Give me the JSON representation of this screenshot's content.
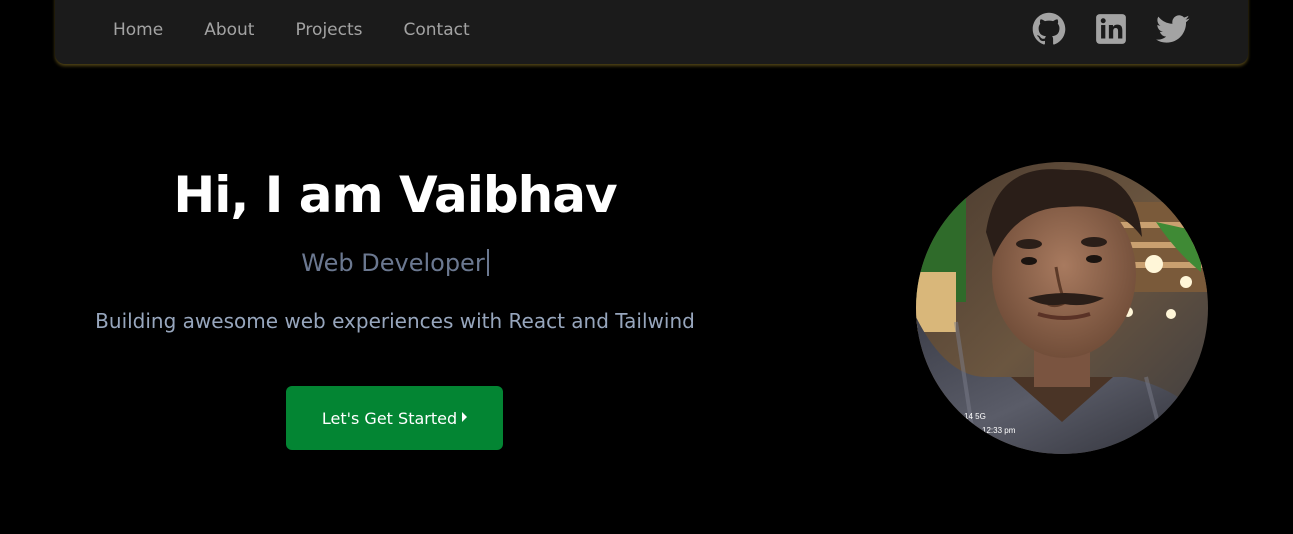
{
  "nav": {
    "links": [
      {
        "label": "Home"
      },
      {
        "label": "About"
      },
      {
        "label": "Projects"
      },
      {
        "label": "Contact"
      }
    ],
    "social_icons": [
      "github-icon",
      "linkedin-icon",
      "twitter-icon"
    ]
  },
  "hero": {
    "title": "Hi, I am Vaibhav",
    "role": "Web Developer",
    "tagline": "Building awesome web experiences with React and Tailwind",
    "cta_label": "Let's Get Started"
  },
  "photo": {
    "overlay_lines": [
      "14 5G",
      "12:33 pm"
    ]
  },
  "colors": {
    "background": "#000000",
    "navbar": "#1b1b1b",
    "nav_text": "#a3a3a3",
    "role_text": "#6b7890",
    "tagline_text": "#97a6bd",
    "cta": "#038533",
    "icon": "#a3a3a3"
  }
}
